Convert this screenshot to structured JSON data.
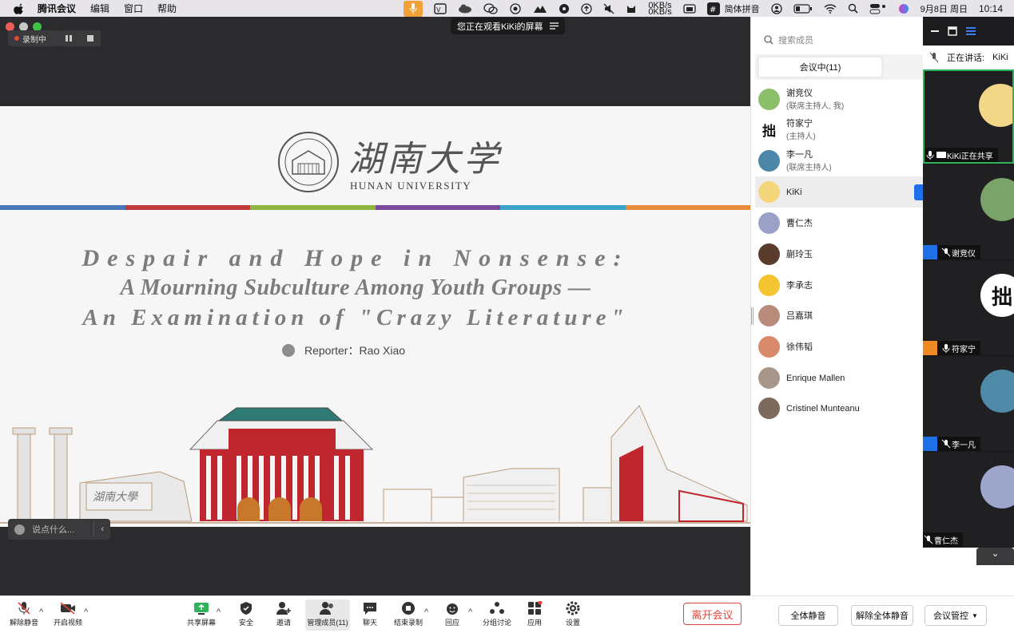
{
  "menubar": {
    "app": "腾讯会议",
    "items": [
      "编辑",
      "窗口",
      "帮助"
    ],
    "netspeed_up": "0KB/s",
    "netspeed_down": "0KB/s",
    "input_method": "简体拼音",
    "datetime": "9月8日 周日",
    "time": "10:14"
  },
  "window": {
    "watching_banner": "您正在观看KiKi的屏幕",
    "recording_label": "录制中",
    "chat_placeholder": "说点什么..."
  },
  "slide": {
    "university_cn": "湖南大学",
    "university_en": "HUNAN UNIVERSITY",
    "title_line1": "Despair and Hope in Nonsense:",
    "title_line2": "A Mourning Subculture Among Youth Groups —",
    "title_line3": "An Examination of \"Crazy Literature\"",
    "reporter": "Reporter：Rao Xiao",
    "gate_inscription": "湖南大學",
    "colors": [
      "#4a78b6",
      "#c0393b",
      "#8fb640",
      "#7b4a9c",
      "#3ba3c9",
      "#e88b3a"
    ]
  },
  "toolbar": {
    "mute_all": "解除静音",
    "video": "开启视频",
    "share": "共享屏幕",
    "security": "安全",
    "invite": "邀请",
    "members": "管理成员(11)",
    "chat": "聊天",
    "record": "结束录制",
    "reaction": "回应",
    "breakout": "分组讨论",
    "apps": "应用",
    "settings": "设置",
    "leave": "离开会议"
  },
  "panel": {
    "search_placeholder": "搜索成员",
    "tab": "会议中(11)",
    "members": [
      {
        "name": "谢竞仪",
        "role": "(联席主持人, 我)",
        "color": "#8bbf6a"
      },
      {
        "name": "符家宁",
        "role": "(主持人)",
        "color": "#ffffff"
      },
      {
        "name": "李一凡",
        "role": "(联席主持人)",
        "color": "#4c86a8"
      },
      {
        "name": "KiKi",
        "role": "",
        "color": "#f3d57a"
      },
      {
        "name": "曹仁杰",
        "role": "",
        "color": "#9aa0c8"
      },
      {
        "name": "蒯玲玉",
        "role": "",
        "color": "#5a3b2c"
      },
      {
        "name": "李承志",
        "role": "",
        "color": "#f5c431"
      },
      {
        "name": "吕嘉琪",
        "role": "",
        "color": "#b98b7a"
      },
      {
        "name": "徐伟韬",
        "role": "",
        "color": "#d88a6a"
      },
      {
        "name": "Enrique Mallen",
        "role": "",
        "color": "#a9968a"
      },
      {
        "name": "Cristinel Munteanu",
        "role": "",
        "color": "#7d6a5c"
      }
    ],
    "host_icon_text": "拙",
    "mute_all_btn": "全体静音",
    "unmute_all_btn": "解除全体静音",
    "control_btn": "会议管控"
  },
  "gallery": {
    "speaking_label": "正在讲话:",
    "speaking_name": "KiKi",
    "tiles": [
      {
        "label": "KiKi正在共享",
        "color": "#f1d787"
      },
      {
        "label": "谢竞仪",
        "color": "#7aa36a"
      },
      {
        "label": "符家宁",
        "color": "#ffffff"
      },
      {
        "label": "李一凡",
        "color": "#4f8aa8"
      },
      {
        "label": "曹仁杰",
        "color": "#9ea6cc"
      }
    ]
  }
}
